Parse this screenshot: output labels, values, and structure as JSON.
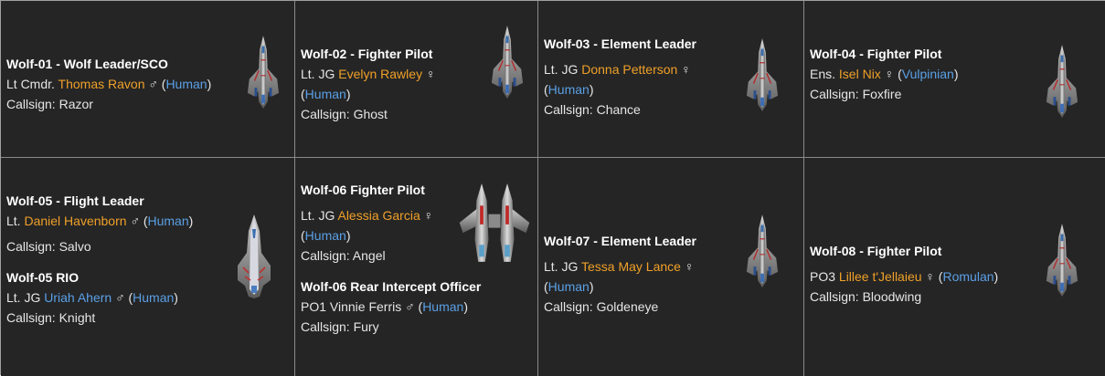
{
  "cards": [
    {
      "header": "Wolf-01 - Wolf Leader/SCO",
      "rank": "Lt Cmdr.",
      "name": "Thomas Ravon",
      "gender": "♂",
      "species": "Human",
      "callsign": "Callsign: Razor"
    },
    {
      "header": "Wolf-02 - Fighter Pilot",
      "rank": "Lt. JG",
      "name": "Evelyn Rawley",
      "gender": "♀",
      "species": "Human",
      "callsign": "Callsign: Ghost"
    },
    {
      "header": "Wolf-03 - Element Leader",
      "rank": "Lt. JG",
      "name": "Donna Petterson",
      "gender": "♀",
      "species": "Human",
      "callsign": "Callsign: Chance"
    },
    {
      "header": "Wolf-04 - Fighter Pilot",
      "rank": "Ens.",
      "name": "Isel Nix",
      "gender": "♀",
      "species": "Vulpinian",
      "callsign": "Callsign: Foxfire"
    },
    {
      "header": "Wolf-05 - Flight Leader",
      "rank": "Lt.",
      "name": "Daniel Havenborn",
      "gender": "♂",
      "species": "Human",
      "callsign": "Callsign: Salvo",
      "rio": {
        "header": "Wolf-05 RIO",
        "rank": "Lt. JG",
        "name": "Uriah Ahern",
        "gender": "♂",
        "species": "Human",
        "callsign": "Callsign: Knight"
      }
    },
    {
      "header": "Wolf-06 Fighter Pilot",
      "rank": "Lt. JG",
      "name": "Alessia Garcia",
      "gender": "♀",
      "species": "Human",
      "callsign": "Callsign: Angel",
      "rio": {
        "header": "Wolf-06 Rear Intercept Officer",
        "rank": "PO1",
        "name": "Vinnie Ferris",
        "gender": "♂",
        "species": "Human",
        "callsign": "Callsign: Fury"
      }
    },
    {
      "header": "Wolf-07 - Element Leader",
      "rank": "Lt. JG",
      "name": "Tessa May Lance",
      "gender": "♀",
      "species": "Human",
      "callsign": "Callsign: Goldeneye"
    },
    {
      "header": "Wolf-08 - Fighter Pilot",
      "rank": "PO3",
      "name": "Lillee t'Jellaieu",
      "gender": "♀",
      "species": "Romulan",
      "callsign": "Callsign: Bloodwing"
    }
  ],
  "colors": {
    "name": "#f0a028",
    "species_link": "#5aa0e6",
    "background": "#252525",
    "border": "#8a8a8a"
  },
  "icons": [
    "fighter-ship-icon",
    "interceptor-ship-icon",
    "twin-hull-ship-icon"
  ]
}
